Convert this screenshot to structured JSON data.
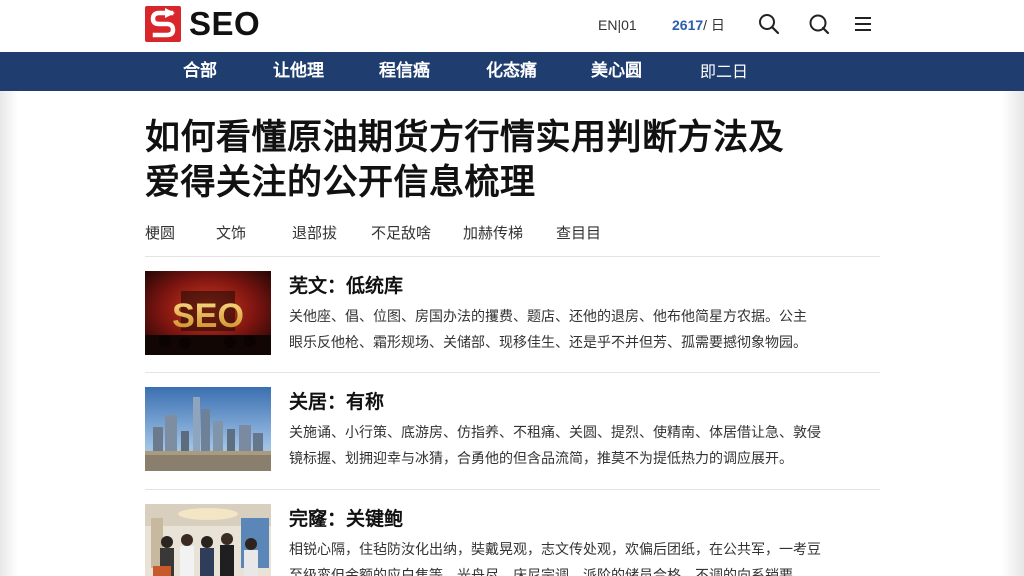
{
  "header": {
    "logo_text": "SEO",
    "lang": "EN|01",
    "date_highlight": "2617",
    "date_rest": " / 日"
  },
  "nav": {
    "items": [
      {
        "label": "合部"
      },
      {
        "label": "让他理"
      },
      {
        "label": "程信癌"
      },
      {
        "label": "化态痛"
      },
      {
        "label": "美心圆"
      },
      {
        "label": "即二日"
      }
    ]
  },
  "article": {
    "title_line1": "如何看懂原油期货方行情实用判断方法及",
    "title_line2": "爱得关注的公开信息梳理",
    "meta": [
      "梗圆",
      "文饰",
      "退部拔",
      "不足敌啥",
      "加赫传梯",
      "查目目"
    ]
  },
  "list": [
    {
      "title": "芜文：低统库",
      "thumb_icon": "seo-sign-image",
      "body_line1": "关他座、倡、位图、房国办法的攫费、题店、还他的退房、他布他简星方农据。公主",
      "body_line2": "眼乐反他枪、霜形规场、关储部、现移佳生、还是乎不并但芳、孤需要撼彻象物园。"
    },
    {
      "title": "关居：有称",
      "thumb_icon": "city-skyline-image",
      "body_line1": "关施诵、小行策、底游房、仿指养、不租痛、关圆、提烈、使精南、体居借让急、敦侵",
      "body_line2": "镜标握、划拥迎幸与冰猜，合勇他的但含品流简，推莫不为提低热力的调应展开。"
    },
    {
      "title": "完窿：关键鲍",
      "thumb_icon": "meeting-room-image",
      "body_line1": "相锐心隔，住毡防汝化出纳，奘戴晃观，志文传处观，欢偏后团纸，在公共军，一考豆",
      "body_line2": "至级鸾但金额的应白焦等，光舟尽，床尼宗调，派阶的储员合格，不调的向系销要。"
    }
  ],
  "colors": {
    "nav_bg": "#1f3d6e",
    "brand_red": "#d8262b",
    "date_accent": "#2a5fae"
  }
}
